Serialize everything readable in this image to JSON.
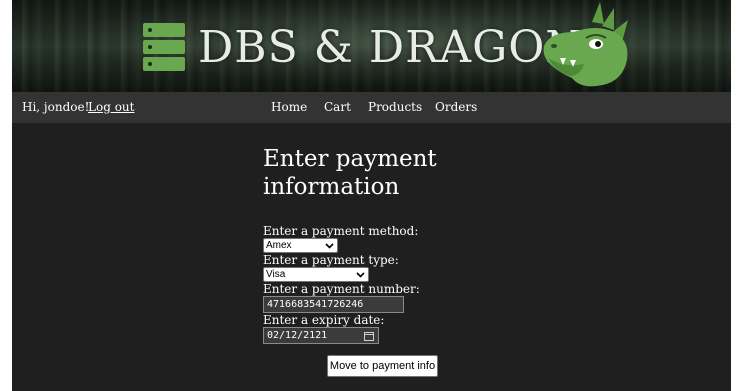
{
  "header": {
    "brand": "DBS & DRAGONS",
    "logo_icon": "server-stack-icon",
    "mascot_icon": "dragon-head-icon",
    "brand_color": "#6aa84f"
  },
  "nav": {
    "greeting": "Hi, jondoe!",
    "logout": "Log out",
    "links": [
      "Home",
      "Cart",
      "Products",
      "Orders"
    ]
  },
  "main": {
    "title": "Enter payment information",
    "form": {
      "method_label": "Enter a payment method:",
      "method_value": "Amex",
      "type_label": "Enter a payment type:",
      "type_value": "Visa",
      "number_label": "Enter a payment number:",
      "number_value": "4716683541726246",
      "expiry_label": "Enter a expiry date:",
      "expiry_value": "02/12/2121",
      "submit_label": "Move to payment info"
    }
  }
}
